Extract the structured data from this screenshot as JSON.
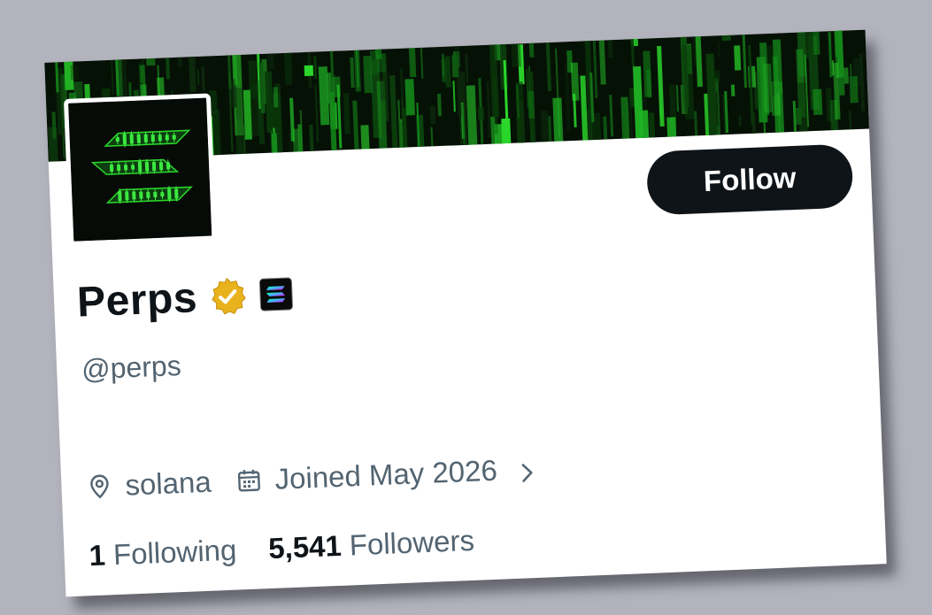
{
  "profile": {
    "display_name": "Perps",
    "handle": "@perps",
    "location": "solana",
    "joined": "Joined May 2026",
    "following_count": "1",
    "following_label": "Following",
    "followers_count": "5,541",
    "followers_label": "Followers"
  },
  "actions": {
    "follow_label": "Follow"
  },
  "icons": {
    "verified": "verified-badge-icon",
    "affiliate": "solana-affiliate-icon",
    "location": "location-pin-icon",
    "calendar": "calendar-icon",
    "chevron": "chevron-right-icon"
  },
  "colors": {
    "banner_accent": "#2bd92b",
    "verified_badge": "#e8b21c",
    "button_bg": "#0f1419",
    "secondary_text": "#536471",
    "backdrop": "#b3b3bd"
  }
}
